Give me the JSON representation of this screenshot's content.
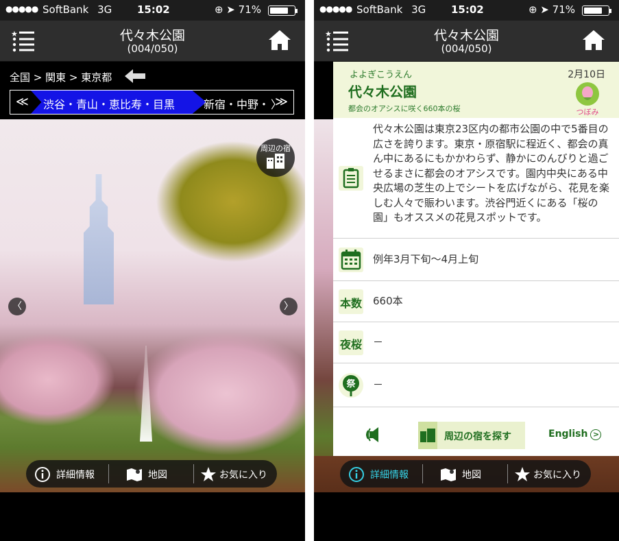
{
  "status_bar": {
    "signal": "●●●●●",
    "carrier": "SoftBank",
    "network": "3G",
    "time": "15:02",
    "battery": "71%"
  },
  "nav": {
    "title": "代々木公園",
    "counter": "(004/050)"
  },
  "breadcrumb": "全国 > 関東 > 東京都",
  "area_bar": {
    "prev": "≪",
    "active": "渋谷・青山・恵比寿・目黒",
    "next": "新宿・中野・",
    "next_chevron": "〉",
    "more": "≫"
  },
  "photo": {
    "nearby_label": "周辺の宿",
    "prev_arrow": "〈",
    "next_arrow": "〉"
  },
  "tabs": {
    "info": "詳細情報",
    "map": "地図",
    "favorite": "お気に入り"
  },
  "detail": {
    "kana": "よよぎこうえん",
    "date": "2月10日",
    "name": "代々木公園",
    "subtitle": "都会のオアシスに咲く660本の桜",
    "bloom_status": "つぼみ",
    "description": "代々木公園は東京23区内の都市公園の中で5番目の広さを誇ります。東京・原宿駅に程近く、都会の真ん中にあるにもかかわらず、静かにのんびりと過ごせるまさに都会のオアシスです。園内中央にある中央広場の芝生の上でシートを広げながら、花見を楽しむ人々で賑わいます。渋谷門近くにある「桜の園」もオススメの花見スポットです。",
    "season": "例年3月下旬〜4月上旬",
    "count_icon": "本数",
    "count": "660本",
    "night_icon": "夜桜",
    "night": "－",
    "festival_icon": "祭",
    "festival": "－",
    "hotel_search": "周辺の宿を探す",
    "english": "English"
  },
  "colors": {
    "accent_green": "#1f6e1f",
    "panel_header_bg": "#f1f6da",
    "area_active_blue": "#1414e6",
    "bloom_pink": "#e04a8a"
  }
}
